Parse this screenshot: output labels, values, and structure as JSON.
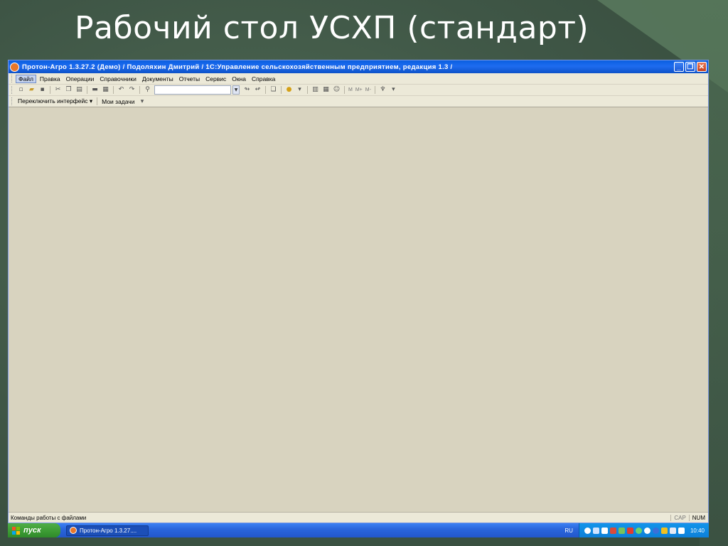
{
  "slide": {
    "title": "Рабочий стол УСХП (стандарт)"
  },
  "window": {
    "title": "Протон-Агро 1.3.27.2 (Демо) / Подоляхин Дмитрий / 1С:Управление сельскохозяйственным предприятием, редакция 1.3 /",
    "minimize": "_",
    "restore": "❐",
    "close": "✕"
  },
  "menu": {
    "items": [
      "Файл",
      "Правка",
      "Операции",
      "Справочники",
      "Документы",
      "Отчеты",
      "Сервис",
      "Окна",
      "Справка"
    ]
  },
  "toolbar": {
    "memory_buttons": [
      "M",
      "M+",
      "M-"
    ]
  },
  "panel": {
    "switch_interface": "Переключить интерфейс ▾",
    "my_tasks": "Мои задачи"
  },
  "status": {
    "text": "Команды работы с файлами",
    "cap": "CAP",
    "num": "NUM"
  },
  "taskbar": {
    "start": "пуск",
    "task": "Протон-Агро 1.3.27....",
    "lang": "RU",
    "clock": "10:40"
  },
  "colors": {
    "slide_bg": "#3f5646",
    "titlebar": "#0a5fe0",
    "workspace": "#d8d3bf",
    "chrome": "#ece9d8",
    "start_button": "#3b9a33",
    "taskbar": "#2a66dc"
  }
}
